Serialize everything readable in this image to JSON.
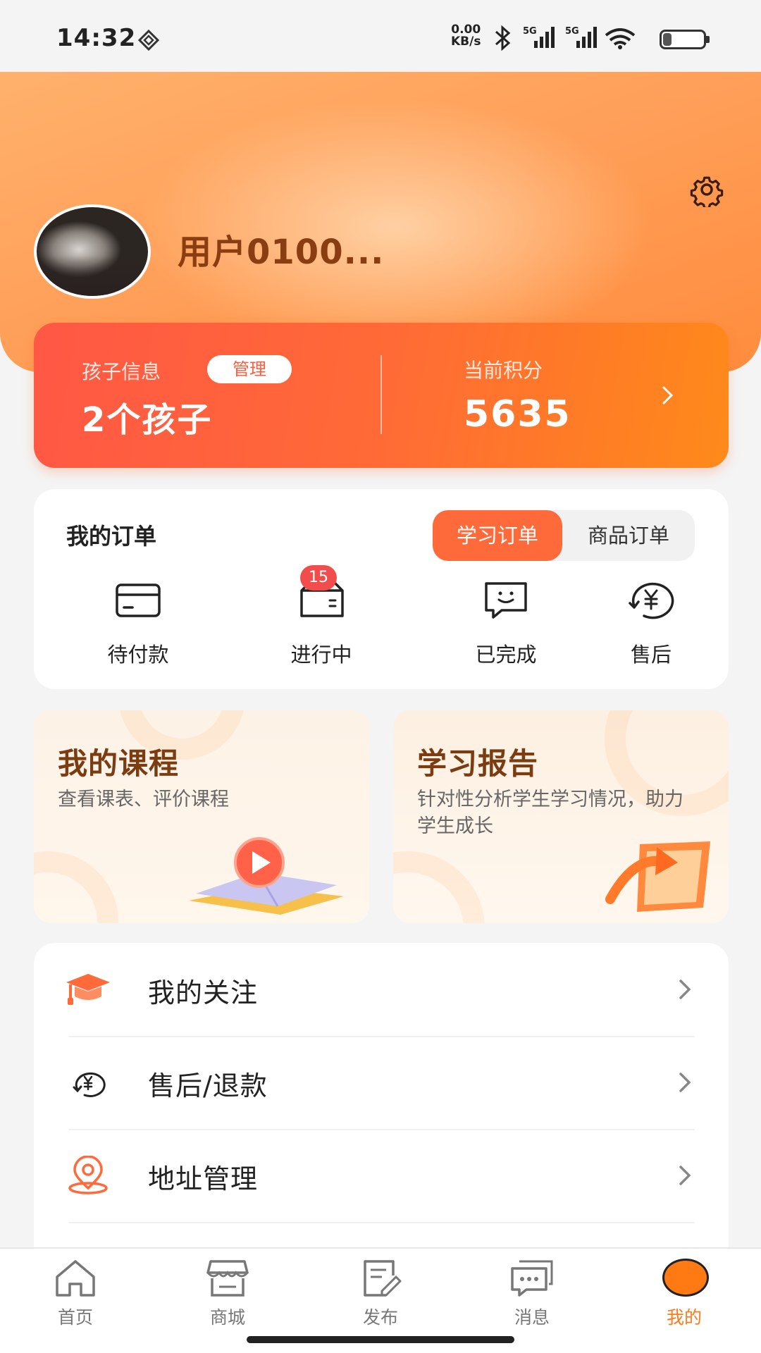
{
  "status_bar": {
    "time": "14:32",
    "net_speed_value": "0.00",
    "net_speed_unit": "KB/s",
    "signal1_label": "5G",
    "signal2_label": "5G",
    "battery": "21",
    "battery_level": 0.21
  },
  "profile": {
    "username": "用户0100..."
  },
  "points_card": {
    "child_label": "孩子信息",
    "manage_label": "管理",
    "child_count": "2个孩子",
    "points_label": "当前积分",
    "points_value": "5635"
  },
  "orders": {
    "title": "我的订单",
    "tabs": [
      {
        "label": "学习订单",
        "active": true
      },
      {
        "label": "商品订单",
        "active": false
      }
    ],
    "items": [
      {
        "label": "待付款",
        "icon": "card-icon"
      },
      {
        "label": "进行中",
        "icon": "box-icon",
        "badge": "15"
      },
      {
        "label": "已完成",
        "icon": "smile-chat-icon"
      },
      {
        "label": "售后",
        "icon": "yen-refund-icon"
      }
    ]
  },
  "features": [
    {
      "title": "我的课程",
      "subtitle": "查看课表、评价课程",
      "illustration": "book-play-illustration"
    },
    {
      "title": "学习报告",
      "subtitle": "针对性分析学生学习情况，助力学生成长",
      "illustration": "report-arrow-illustration"
    }
  ],
  "menu": [
    {
      "label": "我的关注",
      "icon": "graduation-cap-icon"
    },
    {
      "label": "售后/退款",
      "icon": "yen-refund-icon"
    },
    {
      "label": "地址管理",
      "icon": "location-pin-icon"
    }
  ],
  "nav": [
    {
      "label": "首页",
      "icon": "home-icon",
      "active": false
    },
    {
      "label": "商城",
      "icon": "store-icon",
      "active": false
    },
    {
      "label": "发布",
      "icon": "edit-icon",
      "active": false
    },
    {
      "label": "消息",
      "icon": "message-icon",
      "active": false
    },
    {
      "label": "我的",
      "icon": "profile-icon",
      "active": true
    }
  ],
  "colors": {
    "accent": "#ff6a3a",
    "header_orange": "#ffa05a",
    "badge_red": "#f24d4d",
    "feature_title": "#7a3c10",
    "nav_active": "#ff7a1a"
  }
}
